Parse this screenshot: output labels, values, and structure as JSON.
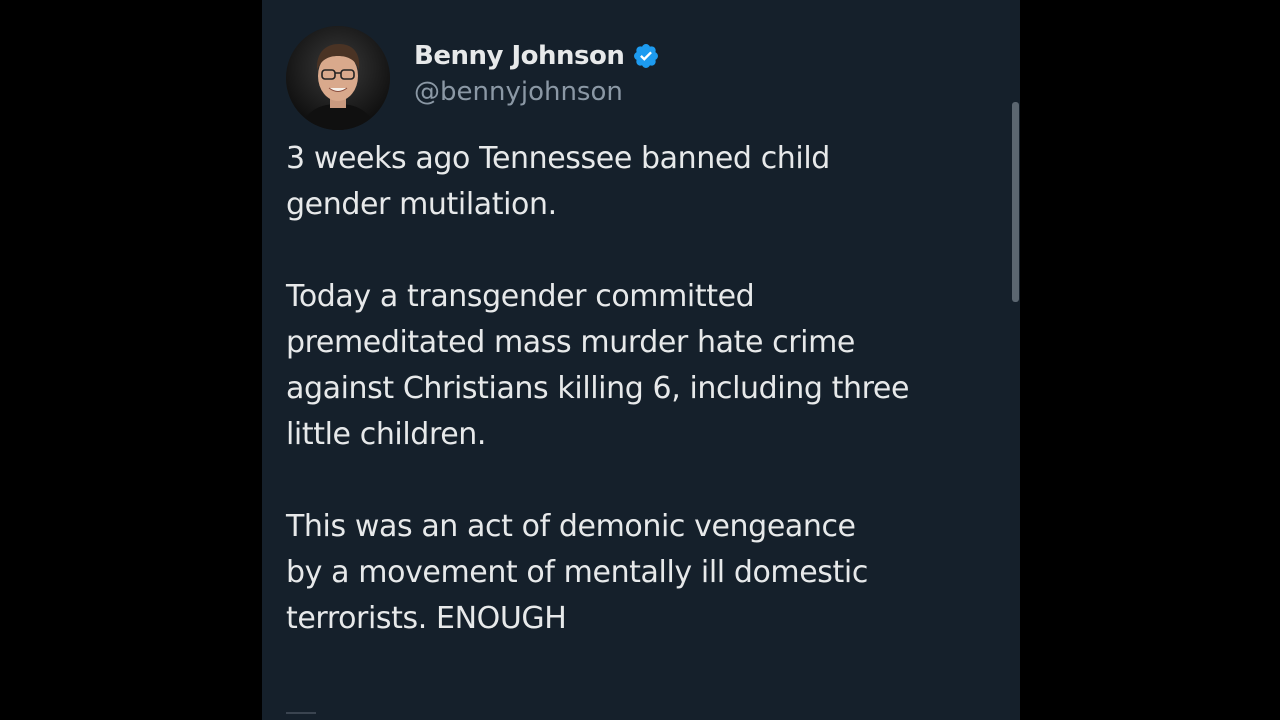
{
  "tweet": {
    "author": {
      "display_name": "Benny Johnson",
      "handle": "@bennyjohnson",
      "verified": true,
      "verified_icon": "verified-badge-icon"
    },
    "paragraphs": [
      "3 weeks ago Tennessee banned child\ngender mutilation.",
      "Today a transgender committed\npremeditated mass murder hate crime\nagainst Christians killing 6, including three\nlittle children.",
      "This was an act of demonic vengeance\nby a movement of mentally ill domestic\nterrorists. ENOUGH"
    ]
  },
  "colors": {
    "background": "#15202b",
    "outer": "#000000",
    "text": "#e7e9ea",
    "secondary_text": "#8b98a5",
    "verified": "#1d9bf0"
  }
}
